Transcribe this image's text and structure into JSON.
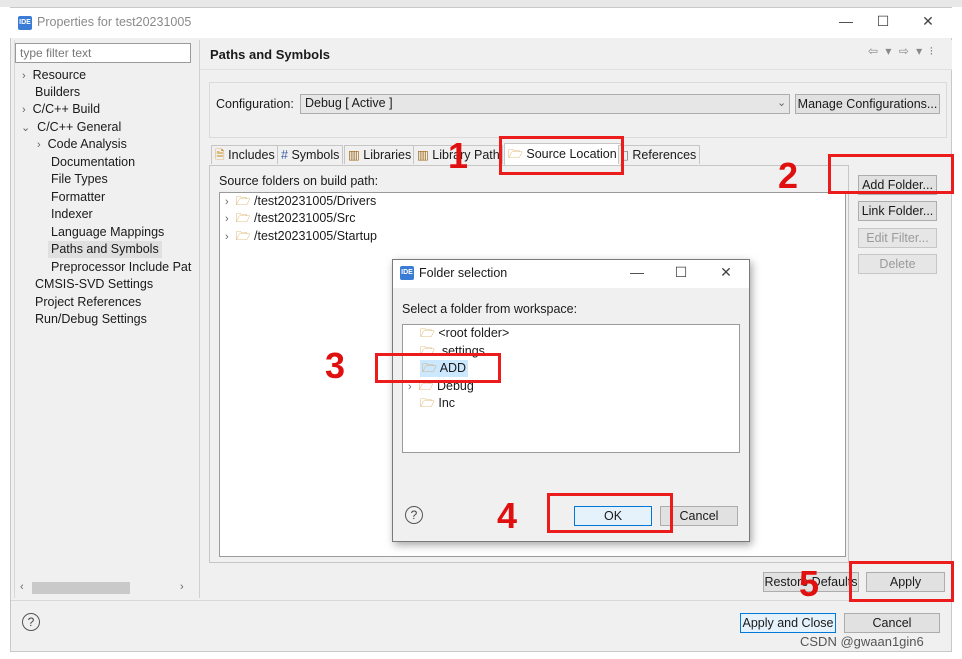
{
  "window": {
    "title": "Properties for test20231005",
    "minimize": "—",
    "maximize": "☐",
    "close": "✕"
  },
  "filter": {
    "placeholder": "type filter text"
  },
  "nav": {
    "resource": "Resource",
    "builders": "Builders",
    "cpp_build": "C/C++ Build",
    "cpp_general": "C/C++ General",
    "code_analysis": "Code Analysis",
    "documentation": "Documentation",
    "file_types": "File Types",
    "formatter": "Formatter",
    "indexer": "Indexer",
    "language_mappings": "Language Mappings",
    "paths_symbols": "Paths and Symbols",
    "preprocessor": "Preprocessor Include Path",
    "cmsis": "CMSIS-SVD Settings",
    "project_refs": "Project References",
    "run_debug": "Run/Debug Settings"
  },
  "panel": {
    "title": "Paths and Symbols",
    "config_label": "Configuration:",
    "config_value": "Debug  [ Active ]",
    "manage_btn": "Manage Configurations...",
    "tabs": [
      "Includes",
      "Symbols",
      "Libraries",
      "Library Paths",
      "Source Location",
      "References"
    ],
    "list_label": "Source folders on build path:",
    "folders": [
      "/test20231005/Drivers",
      "/test20231005/Src",
      "/test20231005/Startup"
    ],
    "add_folder": "Add Folder...",
    "link_folder": "Link Folder...",
    "edit_filter": "Edit Filter...",
    "delete": "Delete",
    "restore_defaults": "Restore Defaults",
    "apply": "Apply"
  },
  "footer": {
    "apply_close": "Apply and Close",
    "cancel": "Cancel",
    "help": "?"
  },
  "dialog": {
    "title": "Folder selection",
    "prompt": "Select a folder from workspace:",
    "items": [
      "<root folder>",
      ".settings",
      "ADD",
      "Debug",
      "Inc"
    ],
    "ok": "OK",
    "cancel": "Cancel",
    "help": "?"
  },
  "annotations": {
    "n1": "1",
    "n2": "2",
    "n3": "3",
    "n4": "4",
    "n5": "5",
    "color": "#ec1c1c"
  },
  "watermark": "CSDN @gwaan1gin6",
  "icons": {
    "folder": "folder-icon",
    "ide": "ide-logo",
    "help": "help-icon"
  }
}
